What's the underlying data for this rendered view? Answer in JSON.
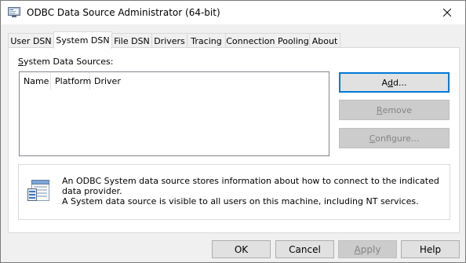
{
  "window": {
    "title": "ODBC Data Source Administrator (64-bit)"
  },
  "tabs": [
    {
      "label": "User DSN"
    },
    {
      "label": "System DSN"
    },
    {
      "label": "File DSN"
    },
    {
      "label": "Drivers"
    },
    {
      "label": "Tracing"
    },
    {
      "label": "Connection Pooling"
    },
    {
      "label": "About"
    }
  ],
  "active_tab": "System DSN",
  "panel": {
    "section_label_first": "S",
    "section_label_rest": "ystem Data Sources:",
    "columns": [
      {
        "label": "Name"
      },
      {
        "label": "Platform"
      },
      {
        "label": "Driver"
      }
    ],
    "rows": [],
    "buttons": {
      "add": {
        "pre": "A",
        "u": "d",
        "post": "d..."
      },
      "remove": {
        "u": "R",
        "post": "emove"
      },
      "configure": {
        "u": "C",
        "post": "onfigure..."
      }
    },
    "info": {
      "line1": "An ODBC System data source stores information about how to connect to the indicated data provider.",
      "line2": "A System data source is visible to all users on this machine, including NT services."
    }
  },
  "footer": {
    "ok": "OK",
    "cancel": "Cancel",
    "apply_u": "A",
    "apply_rest": "pply",
    "help": "Help"
  }
}
